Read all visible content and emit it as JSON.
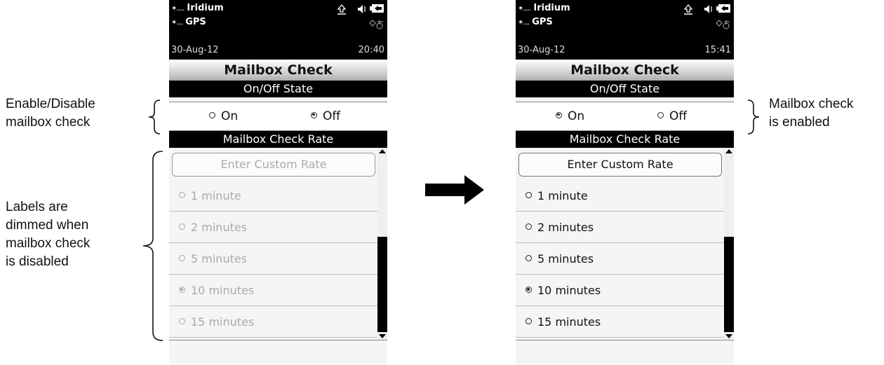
{
  "annotations": {
    "enable_disable": [
      "Enable/Disable",
      "mailbox check"
    ],
    "dimmed": [
      "Labels are",
      "dimmed when",
      "mailbox check",
      "is disabled"
    ],
    "enabled": [
      "Mailbox check",
      "is enabled"
    ]
  },
  "screens": [
    {
      "status": {
        "signal1": "✶.....",
        "network": "Iridium",
        "signal2": "✶....",
        "gps": "GPS",
        "date": "30-Aug-12",
        "time": "20:40"
      },
      "title": "Mailbox Check",
      "onoff_header": "On/Off State",
      "on_label": "On",
      "off_label": "Off",
      "on_selected": false,
      "off_selected": true,
      "rate_header": "Mailbox Check Rate",
      "custom_rate": "Enter Custom Rate",
      "options": [
        "1 minute",
        "2 minutes",
        "5 minutes",
        "10 minutes",
        "15 minutes"
      ],
      "selected_option": "10 minutes",
      "dimmed": true
    },
    {
      "status": {
        "signal1": "✶.....",
        "network": "Iridium",
        "signal2": "✶....",
        "gps": "GPS",
        "date": "30-Aug-12",
        "time": "15:41"
      },
      "title": "Mailbox Check",
      "onoff_header": "On/Off State",
      "on_label": "On",
      "off_label": "Off",
      "on_selected": true,
      "off_selected": false,
      "rate_header": "Mailbox Check Rate",
      "custom_rate": "Enter Custom Rate",
      "options": [
        "1 minute",
        "2 minutes",
        "5 minutes",
        "10 minutes",
        "15 minutes"
      ],
      "selected_option": "10 minutes",
      "dimmed": false
    }
  ],
  "colors": {
    "dimmed_text": "#aaaaaa",
    "status_bg": "#000000"
  }
}
